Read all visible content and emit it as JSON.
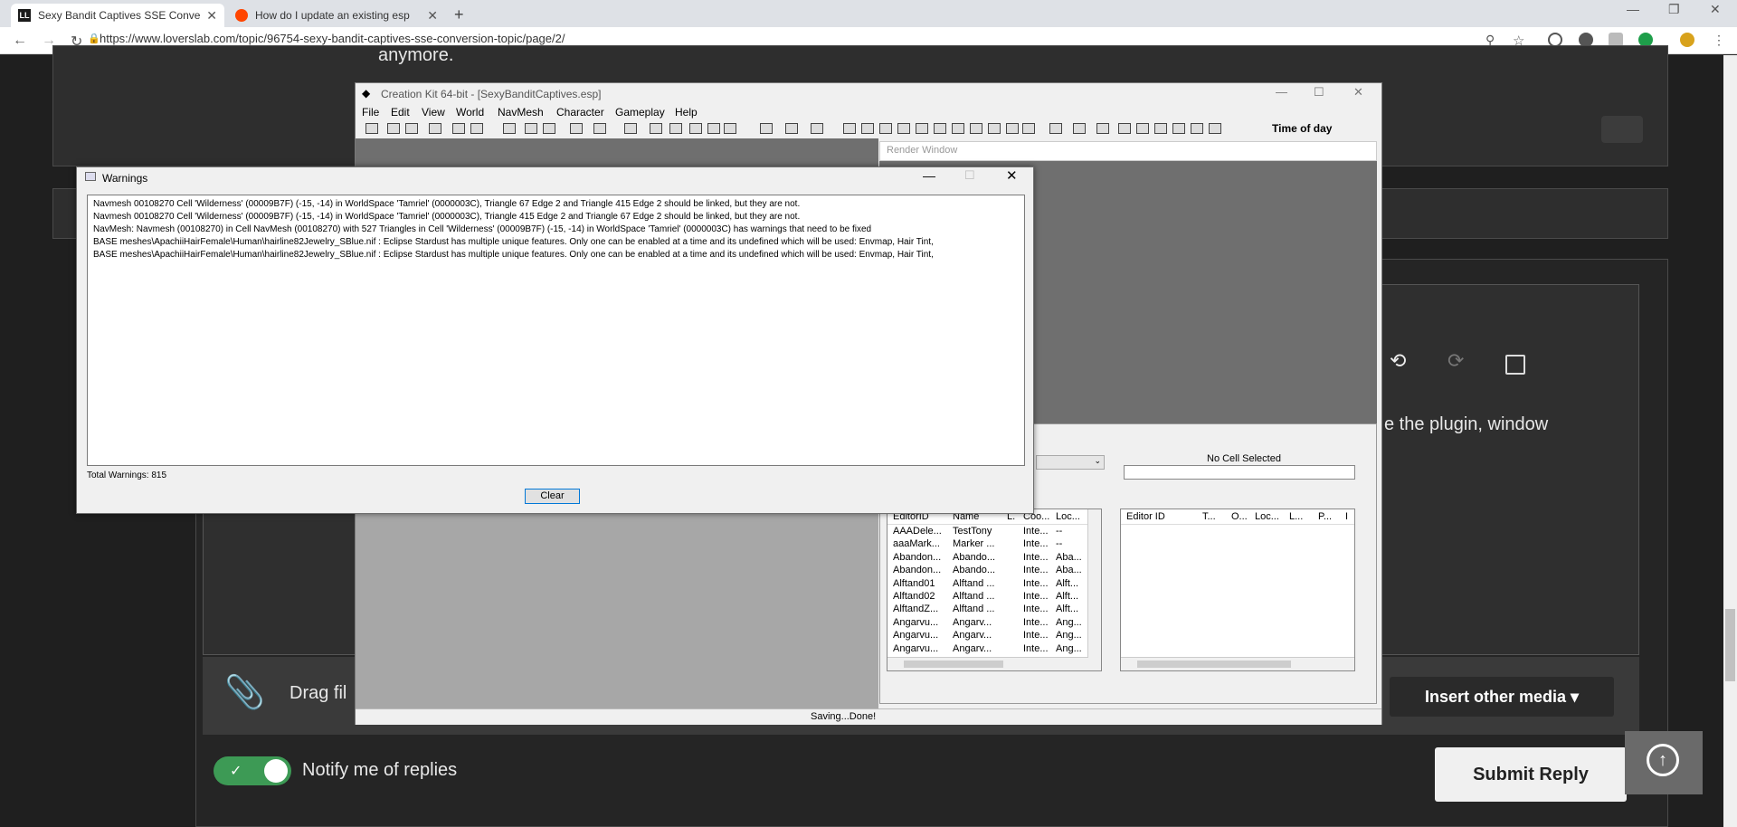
{
  "browser": {
    "tabs": [
      {
        "title": "Sexy Bandit Captives SSE Conver"
      },
      {
        "title": "How do I update an existing esp"
      }
    ],
    "url": "https://www.loverslab.com/topic/96754-sexy-bandit-captives-sse-conversion-topic/page/2/"
  },
  "page": {
    "top_text": "anymore.",
    "editor_text": "e the plugin, window",
    "drag_text": "Drag fil",
    "insert_media": "Insert other media ▾",
    "notify_label": "Notify me of replies",
    "submit_label": "Submit Reply"
  },
  "ck": {
    "title": "Creation Kit 64-bit - [SexyBanditCaptives.esp]",
    "menu": [
      "File",
      "Edit",
      "View",
      "World",
      "NavMesh",
      "Character",
      "Gameplay",
      "Help"
    ],
    "time_of_day": "Time of day",
    "render_window": "Render Window",
    "no_cell": "No Cell Selected",
    "status": "Saving...Done!",
    "left_cols": [
      "EditorID",
      "Name",
      "L.",
      "Coo...",
      "Loc..."
    ],
    "left_rows": [
      [
        "AAADele...",
        "TestTony",
        "",
        "Inte...",
        "--"
      ],
      [
        "aaaMark...",
        "Marker ...",
        "",
        "Inte...",
        "--"
      ],
      [
        "Abandon...",
        "Abando...",
        "",
        "Inte...",
        "Aba..."
      ],
      [
        "Abandon...",
        "Abando...",
        "",
        "Inte...",
        "Aba..."
      ],
      [
        "Alftand01",
        "Alftand ...",
        "",
        "Inte...",
        "Alft..."
      ],
      [
        "Alftand02",
        "Alftand ...",
        "",
        "Inte...",
        "Alft..."
      ],
      [
        "AlftandZ...",
        "Alftand ...",
        "",
        "Inte...",
        "Alft..."
      ],
      [
        "Angarvu...",
        "Angarv...",
        "",
        "Inte...",
        "Ang..."
      ],
      [
        "Angarvu...",
        "Angarv...",
        "",
        "Inte...",
        "Ang..."
      ],
      [
        "Angarvu...",
        "Angarv...",
        "",
        "Inte...",
        "Ang..."
      ]
    ],
    "right_cols": [
      "Editor ID",
      "T...",
      "O...",
      "Loc...",
      "L...",
      "P...",
      "I"
    ]
  },
  "warnings": {
    "title": "Warnings",
    "lines": [
      "Navmesh 00108270 Cell 'Wilderness' (00009B7F) (-15, -14) in WorldSpace 'Tamriel' (0000003C), Triangle 67 Edge 2 and Triangle 415 Edge 2 should be linked, but they are not.",
      "Navmesh 00108270 Cell 'Wilderness' (00009B7F) (-15, -14) in WorldSpace 'Tamriel' (0000003C), Triangle 415 Edge 2 and Triangle 67 Edge 2 should be linked, but they are not.",
      "NavMesh: Navmesh (00108270) in Cell NavMesh (00108270) with 527 Triangles in Cell 'Wilderness' (00009B7F) (-15, -14) in WorldSpace 'Tamriel' (0000003C) has warnings that need to be fixed",
      "BASE meshes\\ApachiiHairFemale\\Human\\hairline82Jewelry_SBlue.nif : Eclipse Stardust has multiple unique features. Only one can be enabled at a time and its undefined which will be used: Envmap, Hair Tint,",
      "BASE meshes\\ApachiiHairFemale\\Human\\hairline82Jewelry_SBlue.nif : Eclipse Stardust has multiple unique features. Only one can be enabled at a time and its undefined which will be used: Envmap, Hair Tint,"
    ],
    "total": "Total Warnings: 815",
    "clear_label": "Clear"
  }
}
